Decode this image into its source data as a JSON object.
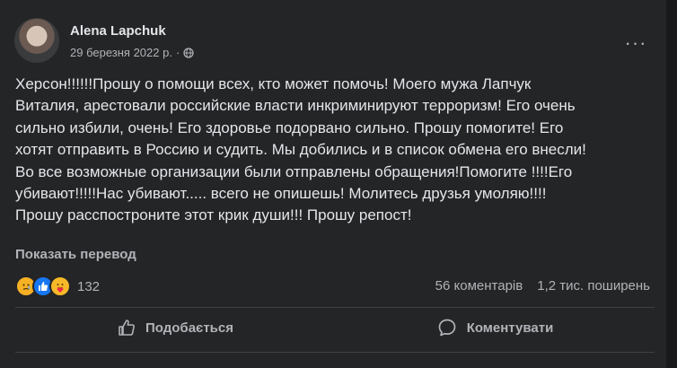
{
  "post": {
    "author": "Alena Lapchuk",
    "date": "29 березня 2022 р.",
    "separator": "·",
    "text": "Херсон!!!!!!Прошу о помощи всех, кто может помочь! Моего мужа Лапчук\nВиталия, арестовали российские власти инкриминируют терроризм! Его очень\nсильно избили, очень! Его здоровье подорвано сильно. Прошу помогите! Его\nхотят отправить в Россию и судить. Мы добились  и в список обмена его внесли!\nВо все возможные организации были отправлены обращения!Помогите !!!!Его\nубивают!!!!!Нас убивают..... всего не опишешь! Молитесь друзья умоляю!!!!\nПрошу расспостроните этот крик души!!! Прошу репост!",
    "translate_label": "Показать перевод",
    "more_label": "···"
  },
  "stats": {
    "reaction_count": "132",
    "comments": "56 коментарів",
    "shares": "1,2 тис. поширень"
  },
  "actions": {
    "like": "Подобається",
    "comment": "Коментувати"
  },
  "colors": {
    "card_bg": "#242526",
    "text": "#e4e6eb",
    "muted": "#b0b3b8",
    "like_blue": "#1877f2",
    "sad_yellow": "#f7b125",
    "care_yellow": "#f7b928"
  },
  "icons": {
    "privacy": "globe-icon",
    "reactions": [
      "sad-reaction-icon",
      "like-reaction-icon",
      "care-reaction-icon"
    ],
    "like_action": "thumbs-up-icon",
    "comment_action": "speech-bubble-icon"
  }
}
